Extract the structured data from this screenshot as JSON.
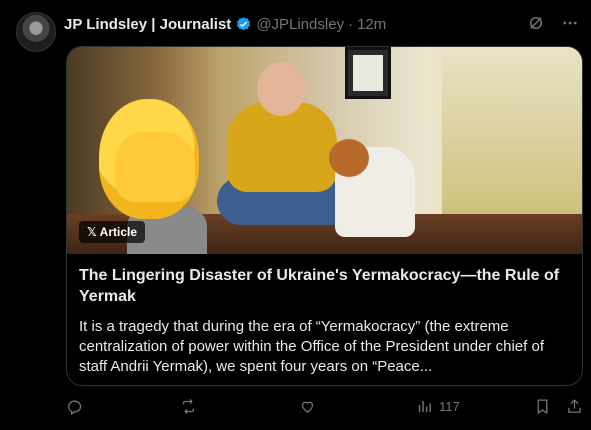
{
  "tweet": {
    "author_name": "JP Lindsley | Journalist",
    "handle": "@JPLindsley",
    "separator": "·",
    "time": "12m",
    "verified_color": "#1d9bf0"
  },
  "card": {
    "badge_x": "𝕏",
    "badge_label": "Article",
    "title": "The Lingering Disaster of Ukraine's Yermakocracy—the Rule of Yermak",
    "description": "It is a tragedy that during the era of “Yermakocracy” (the extreme centralization of power within the Office of the President under chief of staff Andrii Yermak), we spent four years on “Peace..."
  },
  "actions": {
    "views_count": "117"
  },
  "icons": [
    "verified-badge-icon",
    "grok-icon",
    "more-icon",
    "reply-icon",
    "retweet-icon",
    "like-icon",
    "views-icon",
    "bookmark-icon",
    "share-icon"
  ]
}
